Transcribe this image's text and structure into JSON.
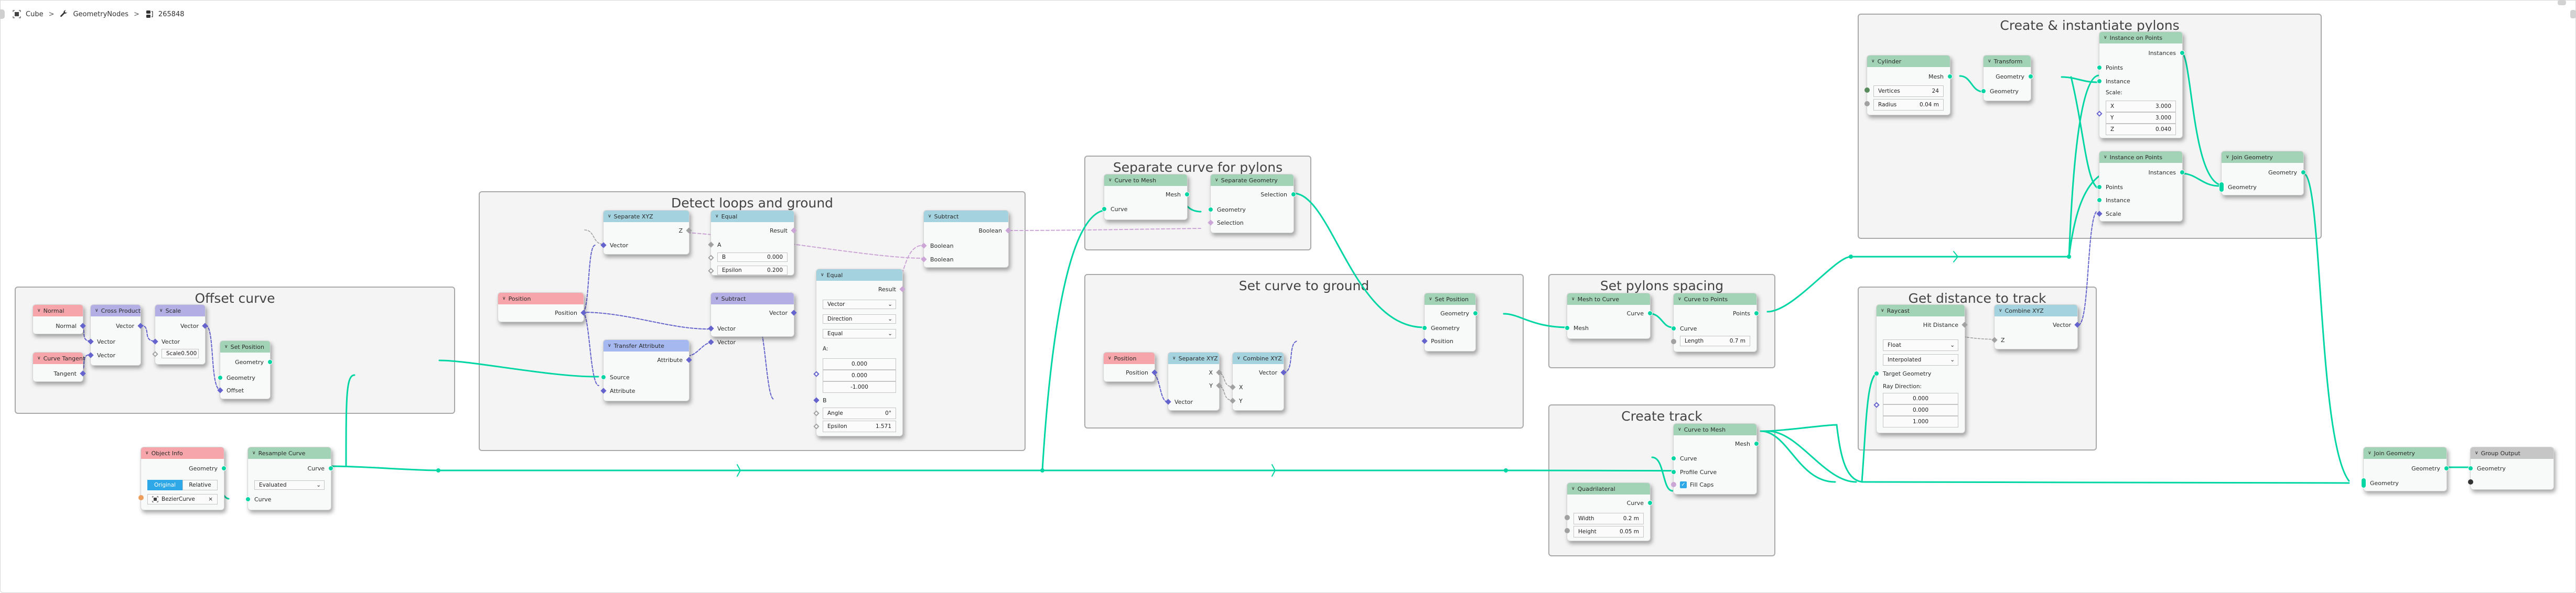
{
  "breadcrumb": {
    "object": "Cube",
    "modifier": "GeometryNodes",
    "node_tree": "265848",
    "separator": ">"
  },
  "frames": {
    "offset_curve": "Offset curve",
    "detect_loops": "Detect loops and ground",
    "separate_pylons": "Separate curve for pylons",
    "set_curve_ground": "Set  curve to ground",
    "set_pylons_spacing": "Set pylons spacing",
    "create_track": "Create track",
    "get_distance": "Get distance to track",
    "create_pylons": "Create & instantiate pylons"
  },
  "nodes": {
    "normal": {
      "title": "Normal",
      "out": "Normal"
    },
    "curve_tangent": {
      "title": "Curve Tangent",
      "out": "Tangent"
    },
    "cross_product": {
      "title": "Cross Product",
      "out": "Vector",
      "in1": "Vector",
      "in2": "Vector"
    },
    "scale": {
      "title": "Scale",
      "out": "Vector",
      "in1": "Vector",
      "scale_label": "Scale",
      "scale_value": "0.500"
    },
    "set_position_1": {
      "title": "Set Position",
      "out": "Geometry",
      "in1": "Geometry",
      "in2": "Offset"
    },
    "object_info": {
      "title": "Object Info",
      "out": "Geometry",
      "mode_original": "Original",
      "mode_relative": "Relative",
      "object": "BezierCurve",
      "clear": "×"
    },
    "resample_curve": {
      "title": "Resample Curve",
      "out": "Curve",
      "mode": "Evaluated",
      "in1": "Curve"
    },
    "position_1": {
      "title": "Position",
      "out": "Position"
    },
    "separate_xyz_1": {
      "title": "Separate XYZ",
      "out": "Z",
      "in1": "Vector"
    },
    "equal_1": {
      "title": "Equal",
      "out": "Result",
      "in1": "A",
      "b_label": "B",
      "b_value": "0.000",
      "eps_label": "Epsilon",
      "eps_value": "0.200"
    },
    "subtract_vec": {
      "title": "Subtract",
      "out": "Vector",
      "in1": "Vector",
      "in2": "Vector"
    },
    "transfer_attribute": {
      "title": "Transfer Attribute",
      "out": "Attribute",
      "in1": "Source",
      "in2": "Attribute"
    },
    "equal_2": {
      "title": "Equal",
      "out": "Result",
      "type": "Vector",
      "mode": "Direction",
      "op": "Equal",
      "a_label": "A:",
      "a_values": [
        "0.000",
        "0.000",
        "-1.000"
      ],
      "b_label": "B",
      "angle_label": "Angle",
      "angle_value": "0°",
      "eps_label": "Epsilon",
      "eps_value": "1.571"
    },
    "subtract_bool": {
      "title": "Subtract",
      "out": "Boolean",
      "in1": "Boolean",
      "in2": "Boolean"
    },
    "curve_to_mesh_1": {
      "title": "Curve to Mesh",
      "out": "Mesh",
      "in1": "Curve"
    },
    "separate_geometry": {
      "title": "Separate Geometry",
      "out": "Selection",
      "in1": "Geometry",
      "in2": "Selection"
    },
    "position_2": {
      "title": "Position",
      "out": "Position"
    },
    "separate_xyz_2": {
      "title": "Separate XYZ",
      "out_x": "X",
      "out_y": "Y",
      "in1": "Vector"
    },
    "combine_xyz_1": {
      "title": "Combine XYZ",
      "out": "Vector",
      "in_x": "X",
      "in_y": "Y"
    },
    "set_position_2": {
      "title": "Set Position",
      "out": "Geometry",
      "in1": "Geometry",
      "in2": "Position"
    },
    "mesh_to_curve": {
      "title": "Mesh to Curve",
      "out": "Curve",
      "in1": "Mesh"
    },
    "curve_to_points": {
      "title": "Curve to Points",
      "out": "Points",
      "in1": "Curve",
      "len_label": "Length",
      "len_value": "0.7 m"
    },
    "curve_to_mesh_2": {
      "title": "Curve to Mesh",
      "out": "Mesh",
      "in1": "Curve",
      "in2": "Profile Curve",
      "fill_caps": "Fill Caps",
      "fill_caps_checked": true
    },
    "quadrilateral": {
      "title": "Quadrilateral",
      "out": "Curve",
      "width_label": "Width",
      "width_value": "0.2 m",
      "height_label": "Height",
      "height_value": "0.05 m"
    },
    "raycast": {
      "title": "Raycast",
      "out": "Hit Distance",
      "type": "Float",
      "mapping": "Interpolated",
      "in1": "Target Geometry",
      "dir_label": "Ray Direction:",
      "dir_values": [
        "0.000",
        "0.000",
        "1.000"
      ]
    },
    "combine_xyz_2": {
      "title": "Combine XYZ",
      "out": "Vector",
      "in_z": "Z"
    },
    "cylinder": {
      "title": "Cylinder",
      "out": "Mesh",
      "vert_label": "Vertices",
      "vert_value": "24",
      "radius_label": "Radius",
      "radius_value": "0.04 m"
    },
    "transform": {
      "title": "Transform",
      "out": "Geometry",
      "in1": "Geometry"
    },
    "instance_on_points_1": {
      "title": "Instance on Points",
      "out": "Instances",
      "in1": "Points",
      "in2": "Instance",
      "scale_label": "Scale:",
      "scale_x_label": "X",
      "scale_x": "3.000",
      "scale_y_label": "Y",
      "scale_y": "3.000",
      "scale_z_label": "Z",
      "scale_z": "0.040"
    },
    "instance_on_points_2": {
      "title": "Instance on Points",
      "out": "Instances",
      "in1": "Points",
      "in2": "Instance",
      "in3": "Scale"
    },
    "join_geometry_1": {
      "title": "Join Geometry",
      "out": "Geometry",
      "in1": "Geometry"
    },
    "join_geometry_2": {
      "title": "Join Geometry",
      "out": "Geometry",
      "in1": "Geometry"
    },
    "group_output": {
      "title": "Group Output",
      "in1": "Geometry"
    }
  },
  "colors": {
    "geometry_socket": "#00d6a3",
    "vector_socket": "#6563cd",
    "float_socket": "#a1a1a1",
    "boolean_socket": "#cca6d6",
    "object_socket": "#ed9e5c",
    "geometry_header": "#a2d3b6",
    "input_header": "#f6a6aa",
    "vector_header": "#b3aee3",
    "converter_header": "#a4d3df",
    "attribute_header": "#a5b9f0",
    "output_header": "#c6c6c6",
    "accent": "#2ea8e6"
  }
}
